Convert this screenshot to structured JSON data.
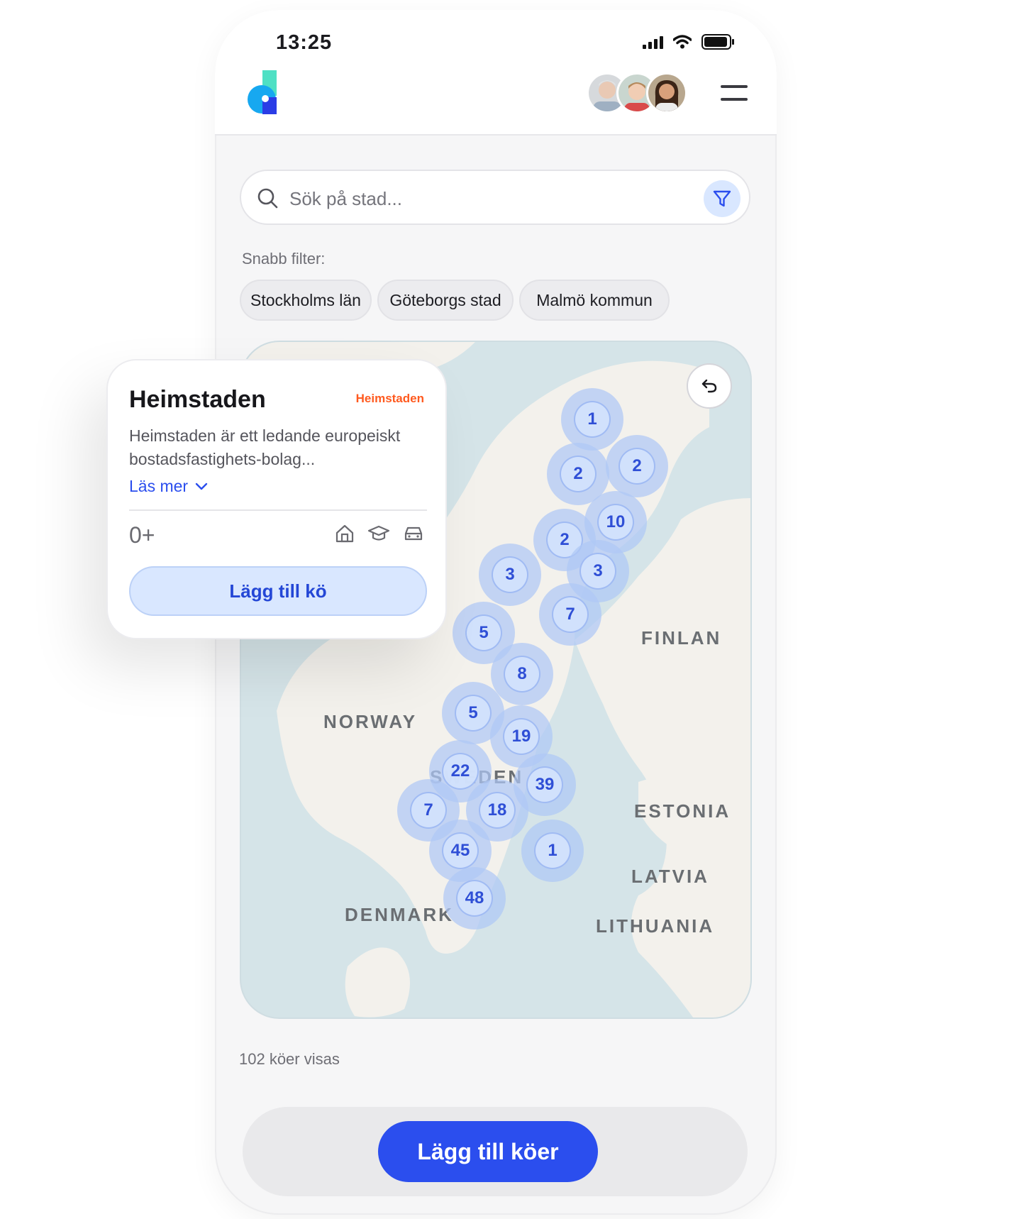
{
  "status_bar": {
    "time": "13:25"
  },
  "search": {
    "placeholder": "Sök på stad..."
  },
  "quick_filters": {
    "label": "Snabb filter:",
    "items": [
      "Stockholms län",
      "Göteborgs stad",
      "Malmö kommun"
    ]
  },
  "map": {
    "countries": [
      "NORWAY",
      "SWEDEN",
      "FINLAN",
      "ESTONIA",
      "LATVIA",
      "LITHUANIA",
      "DENMARK"
    ],
    "clusters": [
      "1",
      "2",
      "2",
      "10",
      "2",
      "3",
      "3",
      "7",
      "5",
      "8",
      "5",
      "19",
      "22",
      "39",
      "7",
      "18",
      "45",
      "1",
      "48"
    ]
  },
  "queue_count": "102 köer visas",
  "bottom": {
    "cta_label": "Lägg till köer"
  },
  "card": {
    "title": "Heimstaden",
    "brand_logo": "Heimstaden",
    "description": "Heimstaden är ett ledande europeiskt bostadsfastighets-bolag...",
    "read_more": "Läs mer",
    "age": "0+",
    "button_label": "Lägg till kö",
    "icons": [
      "house-icon",
      "graduation-cap-icon",
      "car-icon"
    ]
  },
  "colors": {
    "accent": "#2b4eee",
    "brand_orange": "#ff5a1f",
    "cluster": "#2f4fd6"
  }
}
